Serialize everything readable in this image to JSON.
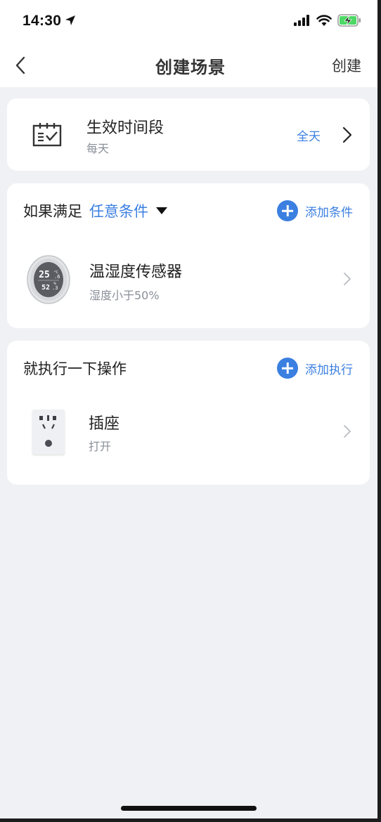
{
  "status_bar": {
    "time": "14:30"
  },
  "nav": {
    "title": "创建场景",
    "action": "创建"
  },
  "schedule": {
    "title": "生效时间段",
    "subtitle": "每天",
    "value": "全天"
  },
  "conditions": {
    "prefix": "如果满足",
    "type": "任意条件",
    "add_label": "添加条件",
    "items": [
      {
        "name": "温湿度传感器",
        "detail": "湿度小于50%"
      }
    ]
  },
  "actions": {
    "heading": "就执行一下操作",
    "add_label": "添加执行",
    "items": [
      {
        "name": "插座",
        "detail": "打开"
      }
    ]
  },
  "sensor_display": {
    "temp": "25",
    "temp_dec": ".6",
    "unit": "°C",
    "humidity": "52",
    "hum_dec": ".3",
    "hum_unit": "%"
  },
  "colors": {
    "accent": "#3b7fe1",
    "background": "#f0f1f4",
    "card": "#ffffff",
    "muted": "#8a8f99"
  },
  "icons": [
    "location-arrow-icon",
    "signal-icon",
    "wifi-icon",
    "battery-charging-icon",
    "back-chevron-icon",
    "calendar-check-icon",
    "chevron-right-icon",
    "triangle-down-icon",
    "plus-circle-icon",
    "sensor-device-icon",
    "socket-device-icon"
  ]
}
